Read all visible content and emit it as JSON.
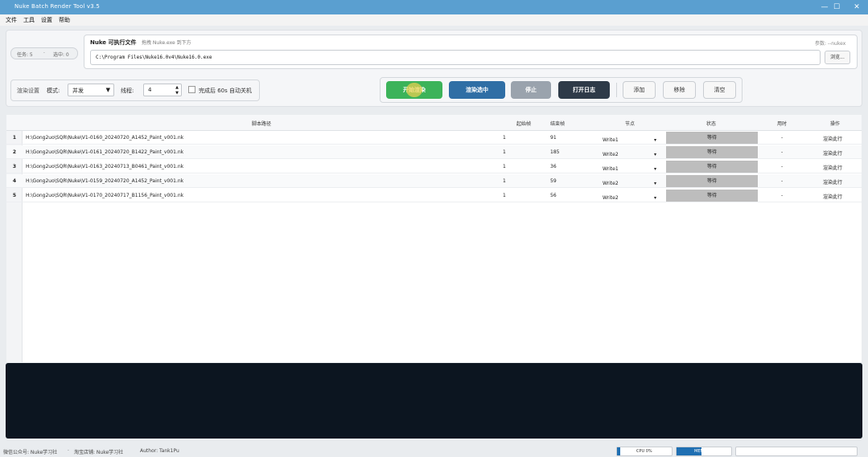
{
  "window": {
    "title": "Nuke Batch Render Tool v3.5",
    "controls": [
      "—",
      "☐",
      "✕"
    ]
  },
  "menu": [
    "文件",
    "工具",
    "设置",
    "帮助"
  ],
  "summary": {
    "tasks": "任务: 5",
    "selected": "选中: 0"
  },
  "nuke": {
    "label": "Nuke 可执行文件",
    "hint": "拖拽 Nuke.exe 到下方",
    "param": "参数: --nukex",
    "path": "C:\\Program Files\\Nuke16.0v4\\Nuke16.0.exe",
    "browse": "浏览..."
  },
  "settings": {
    "group_label": "渲染设置",
    "mode_label": "模式:",
    "mode_value": "并发",
    "threads_label": "线程:",
    "threads_value": "4",
    "shutdown_label": "完成后 60s 自动关机",
    "shutdown_checked": false
  },
  "buttons": {
    "render_all": "开始渲染",
    "render_selected": "渲染选中",
    "stop": "停止",
    "open_log": "打开日志",
    "add": "添加",
    "remove": "移除",
    "clear": "清空"
  },
  "colors": {
    "render_all": "#3cb35a",
    "render_selected": "#2f6ea5",
    "stop": "#9aa3ad",
    "open_log": "#2e3a48",
    "titlebar": "#5a9fd0",
    "state_bg": "#bdbdbd"
  },
  "table": {
    "headers": {
      "script": "脚本路径",
      "start": "起始帧",
      "end": "结束帧",
      "node": "节点",
      "state": "状态",
      "time": "用时",
      "action": "操作"
    },
    "rows": [
      {
        "num": "1",
        "script": "H:\\Gong2uo\\SQR\\Nuke\\V1-0160_20240720_A1452_Paint_v001.nk",
        "start": "1",
        "end": "91",
        "node": "Write1",
        "state": "等待",
        "time": "-",
        "action": "渲染此行"
      },
      {
        "num": "2",
        "script": "H:\\Gong2uo\\SQR\\Nuke\\V1-0161_20240720_B1422_Paint_v001.nk",
        "start": "1",
        "end": "185",
        "node": "Write2",
        "state": "等待",
        "time": "-",
        "action": "渲染此行"
      },
      {
        "num": "3",
        "script": "H:\\Gong2uo\\SQR\\Nuke\\V1-0163_20240713_B0461_Paint_v001.nk",
        "start": "1",
        "end": "36",
        "node": "Write1",
        "state": "等待",
        "time": "-",
        "action": "渲染此行"
      },
      {
        "num": "4",
        "script": "H:\\Gong2uo\\SQR\\Nuke\\V1-0159_20240720_A1452_Paint_v001.nk",
        "start": "1",
        "end": "59",
        "node": "Write2",
        "state": "等待",
        "time": "-",
        "action": "渲染此行"
      },
      {
        "num": "5",
        "script": "H:\\Gong2uo\\SQR\\Nuke\\V1-0170_20240717_B1156_Paint_v001.nk",
        "start": "1",
        "end": "56",
        "node": "Write2",
        "state": "等待",
        "time": "-",
        "action": "渲染此行"
      }
    ]
  },
  "status": {
    "wechat": "微信公众号: Nuke学习社",
    "taobao": "淘宝店铺: Nuke学习社",
    "author": "Author: Tank1Pu",
    "cpu_label": "CPU 0%",
    "cpu_percent": 0,
    "mem_label": "MEM 45%",
    "mem_percent": 45
  }
}
